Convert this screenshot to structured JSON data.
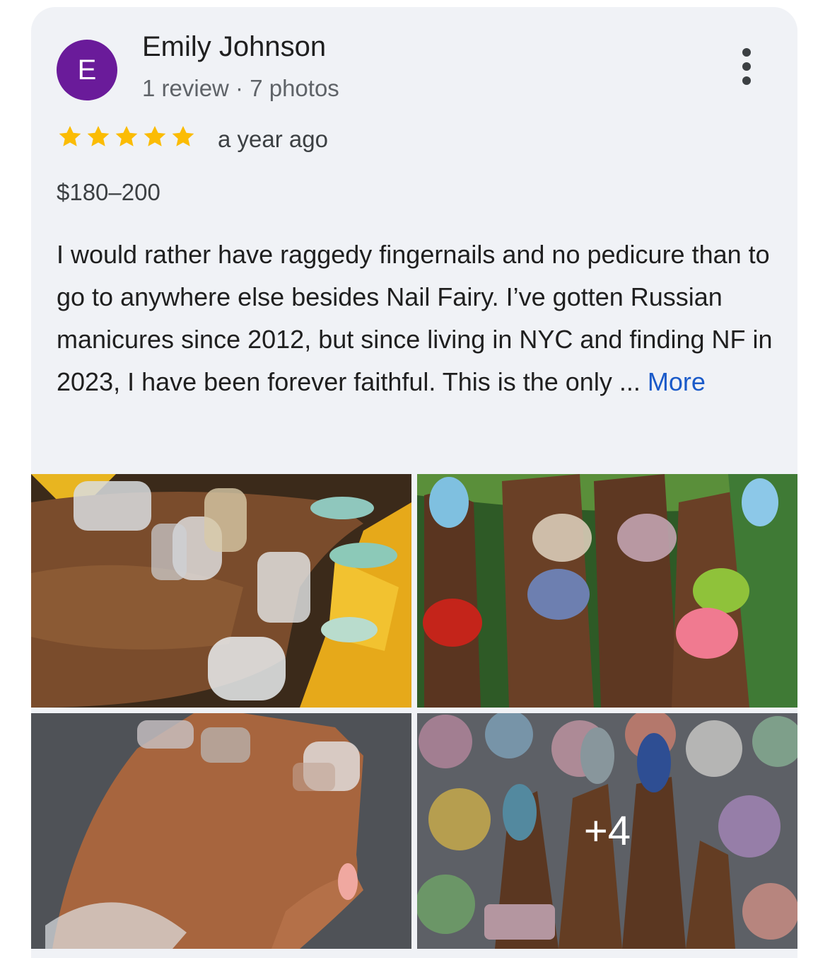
{
  "reviewer": {
    "initial": "E",
    "name": "Emily Johnson",
    "stats": "1 review · 7 photos",
    "avatar_color": "#6a1b9a"
  },
  "rating": {
    "stars": 5,
    "star_color": "#fbbc04",
    "time": "a year ago"
  },
  "price": "$180–200",
  "review": {
    "text": "I would rather have raggedy fingernails and no pedicure than to go to anywhere else besides Nail Fairy. I’ve gotten Russian manicures since 2012, but since living in NYC and finding NF in 2023, I have been forever faithful. This is the only ... ",
    "more_label": "More",
    "link_color": "#1a5ac9"
  },
  "photos": {
    "extra_count": "+4"
  },
  "icons": {
    "menu": "more-vert-icon",
    "star": "star-icon"
  }
}
